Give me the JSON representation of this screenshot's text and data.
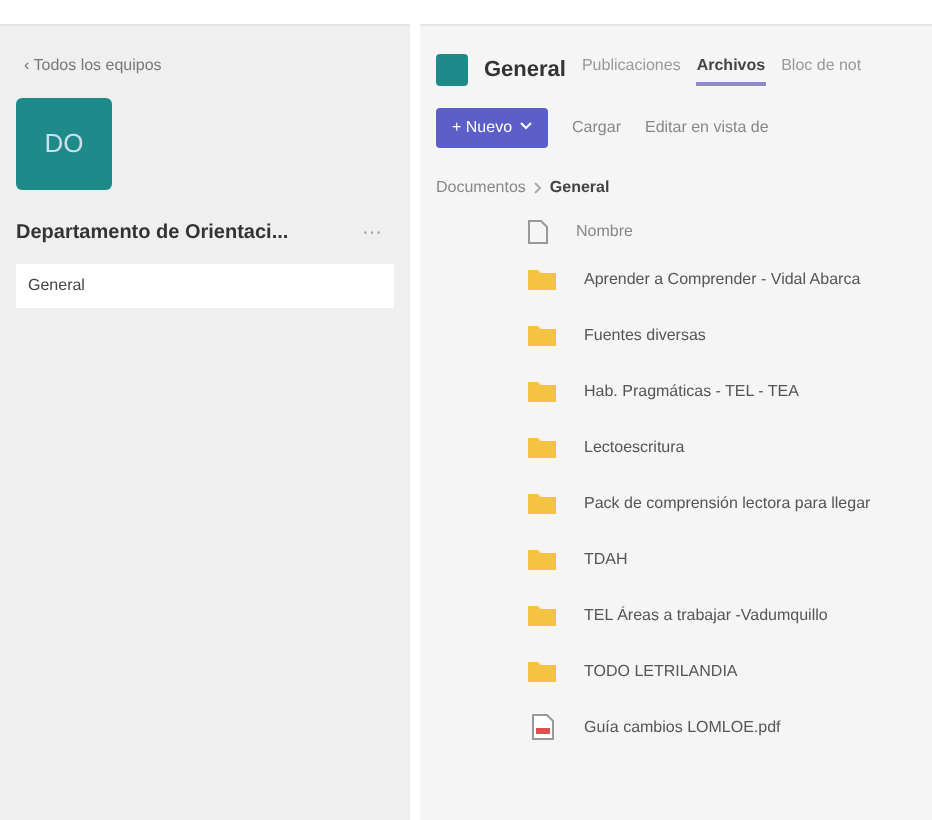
{
  "sidebar": {
    "back_link": "‹ Todos los equipos",
    "team_avatar": "DO",
    "team_name": "Departamento de Orientaci...",
    "more": "···",
    "channels": [
      {
        "label": "General",
        "selected": true
      }
    ]
  },
  "header": {
    "channel_name": "General",
    "tabs": [
      {
        "label": "Publicaciones",
        "selected": false
      },
      {
        "label": "Archivos",
        "selected": true
      },
      {
        "label": "Bloc de not",
        "selected": false
      }
    ]
  },
  "toolbar": {
    "new_button": "+ Nuevo",
    "upload": "Cargar",
    "edit_grid": "Editar en vista de"
  },
  "breadcrumb": {
    "root": "Documentos",
    "current": "General"
  },
  "files": {
    "column": "Nombre",
    "items": [
      {
        "kind": "folder",
        "name": "Aprender a Comprender - Vidal Abarca"
      },
      {
        "kind": "folder",
        "name": "Fuentes diversas"
      },
      {
        "kind": "folder",
        "name": "Hab. Pragmáticas - TEL - TEA"
      },
      {
        "kind": "folder",
        "name": "Lectoescritura"
      },
      {
        "kind": "folder",
        "name": "Pack de comprensión lectora para llegar"
      },
      {
        "kind": "folder",
        "name": "TDAH"
      },
      {
        "kind": "folder",
        "name": "TEL Áreas a trabajar -Vadumquillo"
      },
      {
        "kind": "folder",
        "name": "TODO LETRILANDIA"
      },
      {
        "kind": "pdf",
        "name": "Guía cambios LOMLOE.pdf"
      }
    ]
  }
}
